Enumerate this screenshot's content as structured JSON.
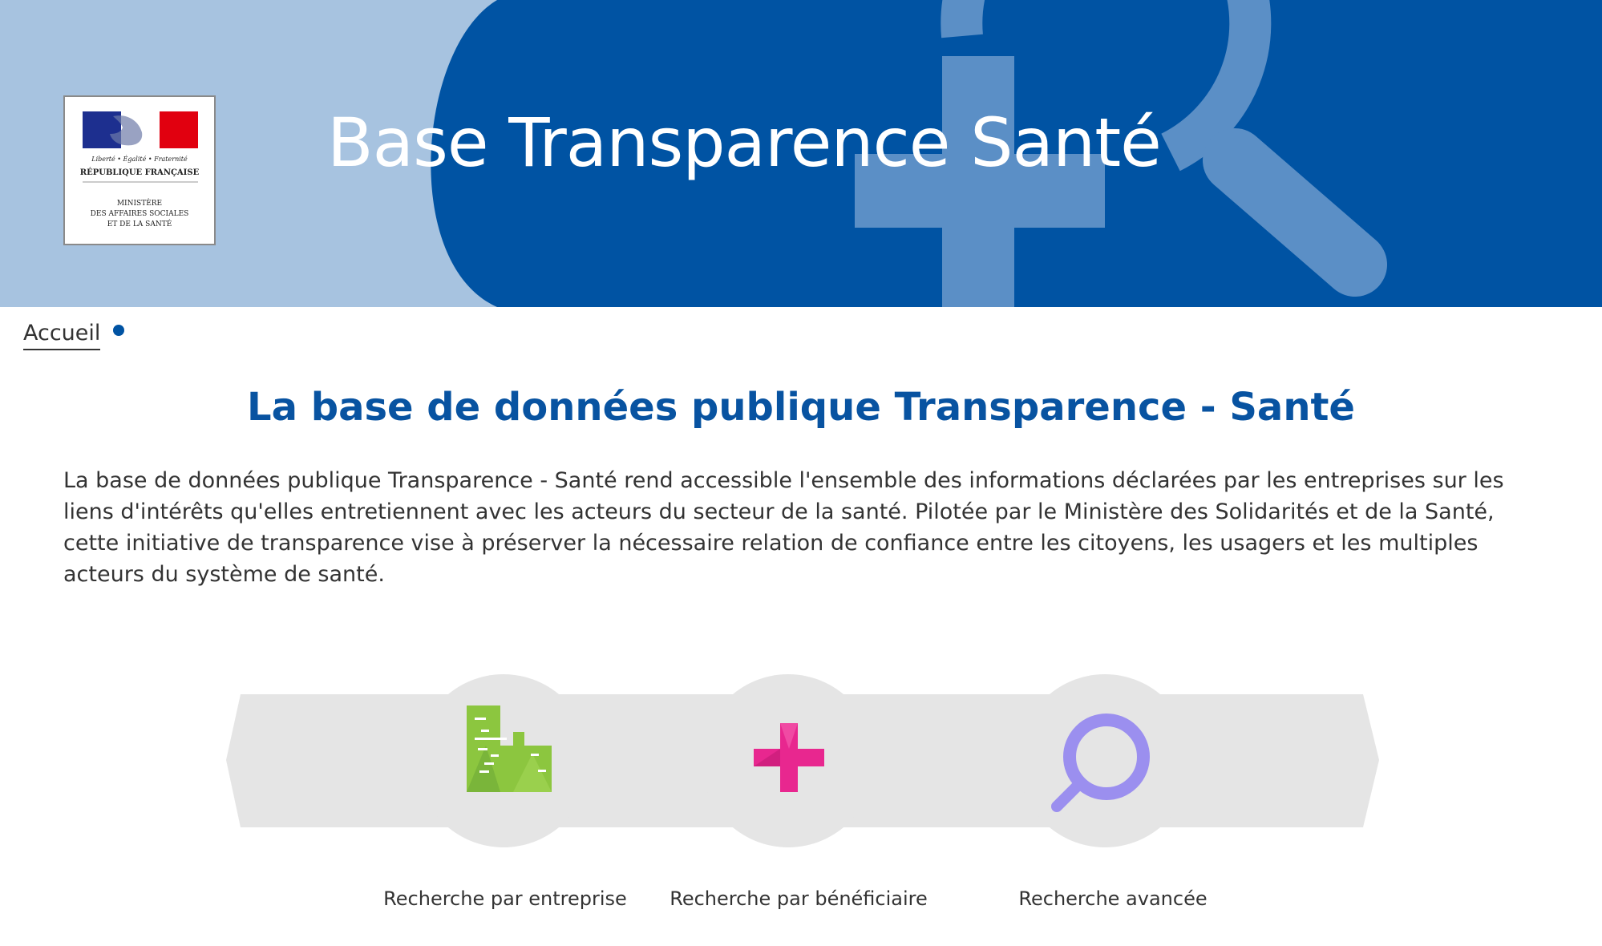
{
  "header": {
    "title": "Base Transparence Santé",
    "logo": {
      "motto": "Liberté • Égalité • Fraternité",
      "republic": "RÉPUBLIQUE FRANÇAISE",
      "ministry_line1": "MINISTÈRE",
      "ministry_line2": "DES AFFAIRES SOCIALES",
      "ministry_line3": "ET DE LA SANTÉ"
    },
    "colors": {
      "band": "#a7c3e0",
      "circle": "#0053a3",
      "icon": "#5b8fc6"
    }
  },
  "breadcrumb": {
    "home": "Accueil"
  },
  "main": {
    "title": "La base de données publique Transparence - Santé",
    "intro": "La base de données publique Transparence - Santé rend accessible l'ensemble des informations déclarées par les entreprises sur les liens d'intérêts qu'elles entretiennent avec les acteurs du secteur de la santé. Pilotée par le Ministère des Solidarités et de la Santé, cette initiative de transparence vise à préserver la nécessaire relation de confiance entre les citoyens, les usagers et les multiples acteurs du système de santé."
  },
  "search_options": [
    {
      "label": "Recherche par entreprise",
      "icon": "building-icon",
      "color": "#8cc63f"
    },
    {
      "label": "Recherche par bénéficiaire",
      "icon": "plus-icon",
      "color": "#e8278f"
    },
    {
      "label": "Recherche avancée",
      "icon": "magnifier-icon",
      "color": "#9b8fef"
    }
  ]
}
